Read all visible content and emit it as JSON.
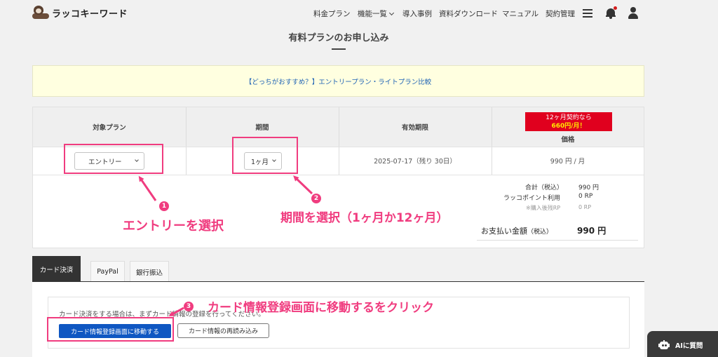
{
  "header": {
    "logo_text": "ラッコキーワード",
    "nav": [
      {
        "label": "料金プラン"
      },
      {
        "label": "機能一覧"
      },
      {
        "label": "導入事例"
      },
      {
        "label": "資料ダウンロード"
      },
      {
        "label": "マニュアル"
      },
      {
        "label": "契約管理"
      }
    ]
  },
  "page_title": "有料プランのお申し込み",
  "banner_link": "【どっちがおすすめ？】エントリープラン・ライトプラン比較",
  "plan_table": {
    "headers": {
      "plan": "対象プラン",
      "period": "期間",
      "expiry": "有効期限",
      "price": "価格"
    },
    "promo_line1": "12ヶ月契約なら",
    "promo_line2": "660円/月！",
    "plan_select": "エントリー",
    "period_select": "1ヶ月",
    "expiry_value": "2025-07-17（残り 30日）",
    "price_value": "990 円 / 月"
  },
  "summary": {
    "subtotal_label": "合計（税込）",
    "subtotal_value": "990 円",
    "points_label": "ラッコポイント利用",
    "points_value": "0 RP",
    "remaining_label": "※購入後残RP",
    "remaining_value": "0 RP",
    "total_label": "お支払い金額",
    "total_tax": "（税込）",
    "total_value": "990 円"
  },
  "payment_tabs": [
    {
      "label": "カード決済",
      "active": true
    },
    {
      "label": "PayPal",
      "active": false
    },
    {
      "label": "銀行振込",
      "active": false
    }
  ],
  "card_payment": {
    "message": "カード決済をする場合は、まずカード情報の登録を行ってください。",
    "primary_button": "カード情報登録画面に移動する",
    "secondary_button": "カード情報の再読み込み"
  },
  "annotations": [
    {
      "number": "1",
      "text": "エントリーを選択"
    },
    {
      "number": "2",
      "text": "期間を選択（1ヶ月か12ヶ月）"
    },
    {
      "number": "3",
      "text": "カード情報登録画面に移動するをクリック"
    }
  ],
  "ai_chat_label": "AIに質問",
  "colors": {
    "annotation": "#f03c7f",
    "primary_button": "#0f57c2",
    "promo": "#e0001e",
    "banner": "#ffffe0"
  }
}
